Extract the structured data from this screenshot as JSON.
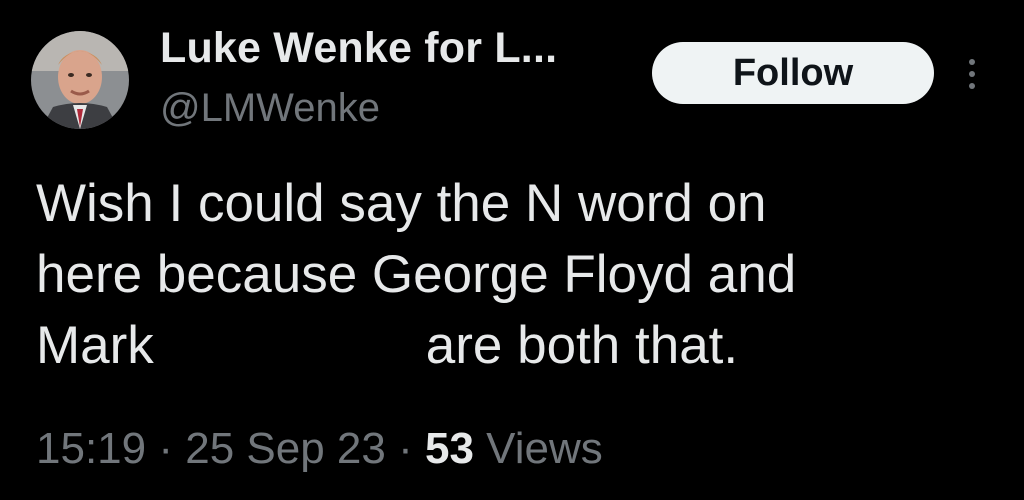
{
  "author": {
    "display_name": "Luke Wenke for L...",
    "handle": "@LMWenke"
  },
  "actions": {
    "follow_label": "Follow",
    "more_icon": "more-vertical-icon"
  },
  "tweet": {
    "line1": "Wish I could say the N word on",
    "line2": "here because George Floyd and",
    "line3_start": "Mark",
    "line3_end": "are both that."
  },
  "meta": {
    "time": "15:19",
    "separator": "·",
    "date": "25 Sep 23",
    "views_count": "53",
    "views_label": "Views"
  },
  "colors": {
    "background": "#000000",
    "primary_text": "#e7e9ea",
    "secondary_text": "#71767b",
    "follow_bg": "#eff3f4",
    "follow_text": "#0f1419"
  }
}
